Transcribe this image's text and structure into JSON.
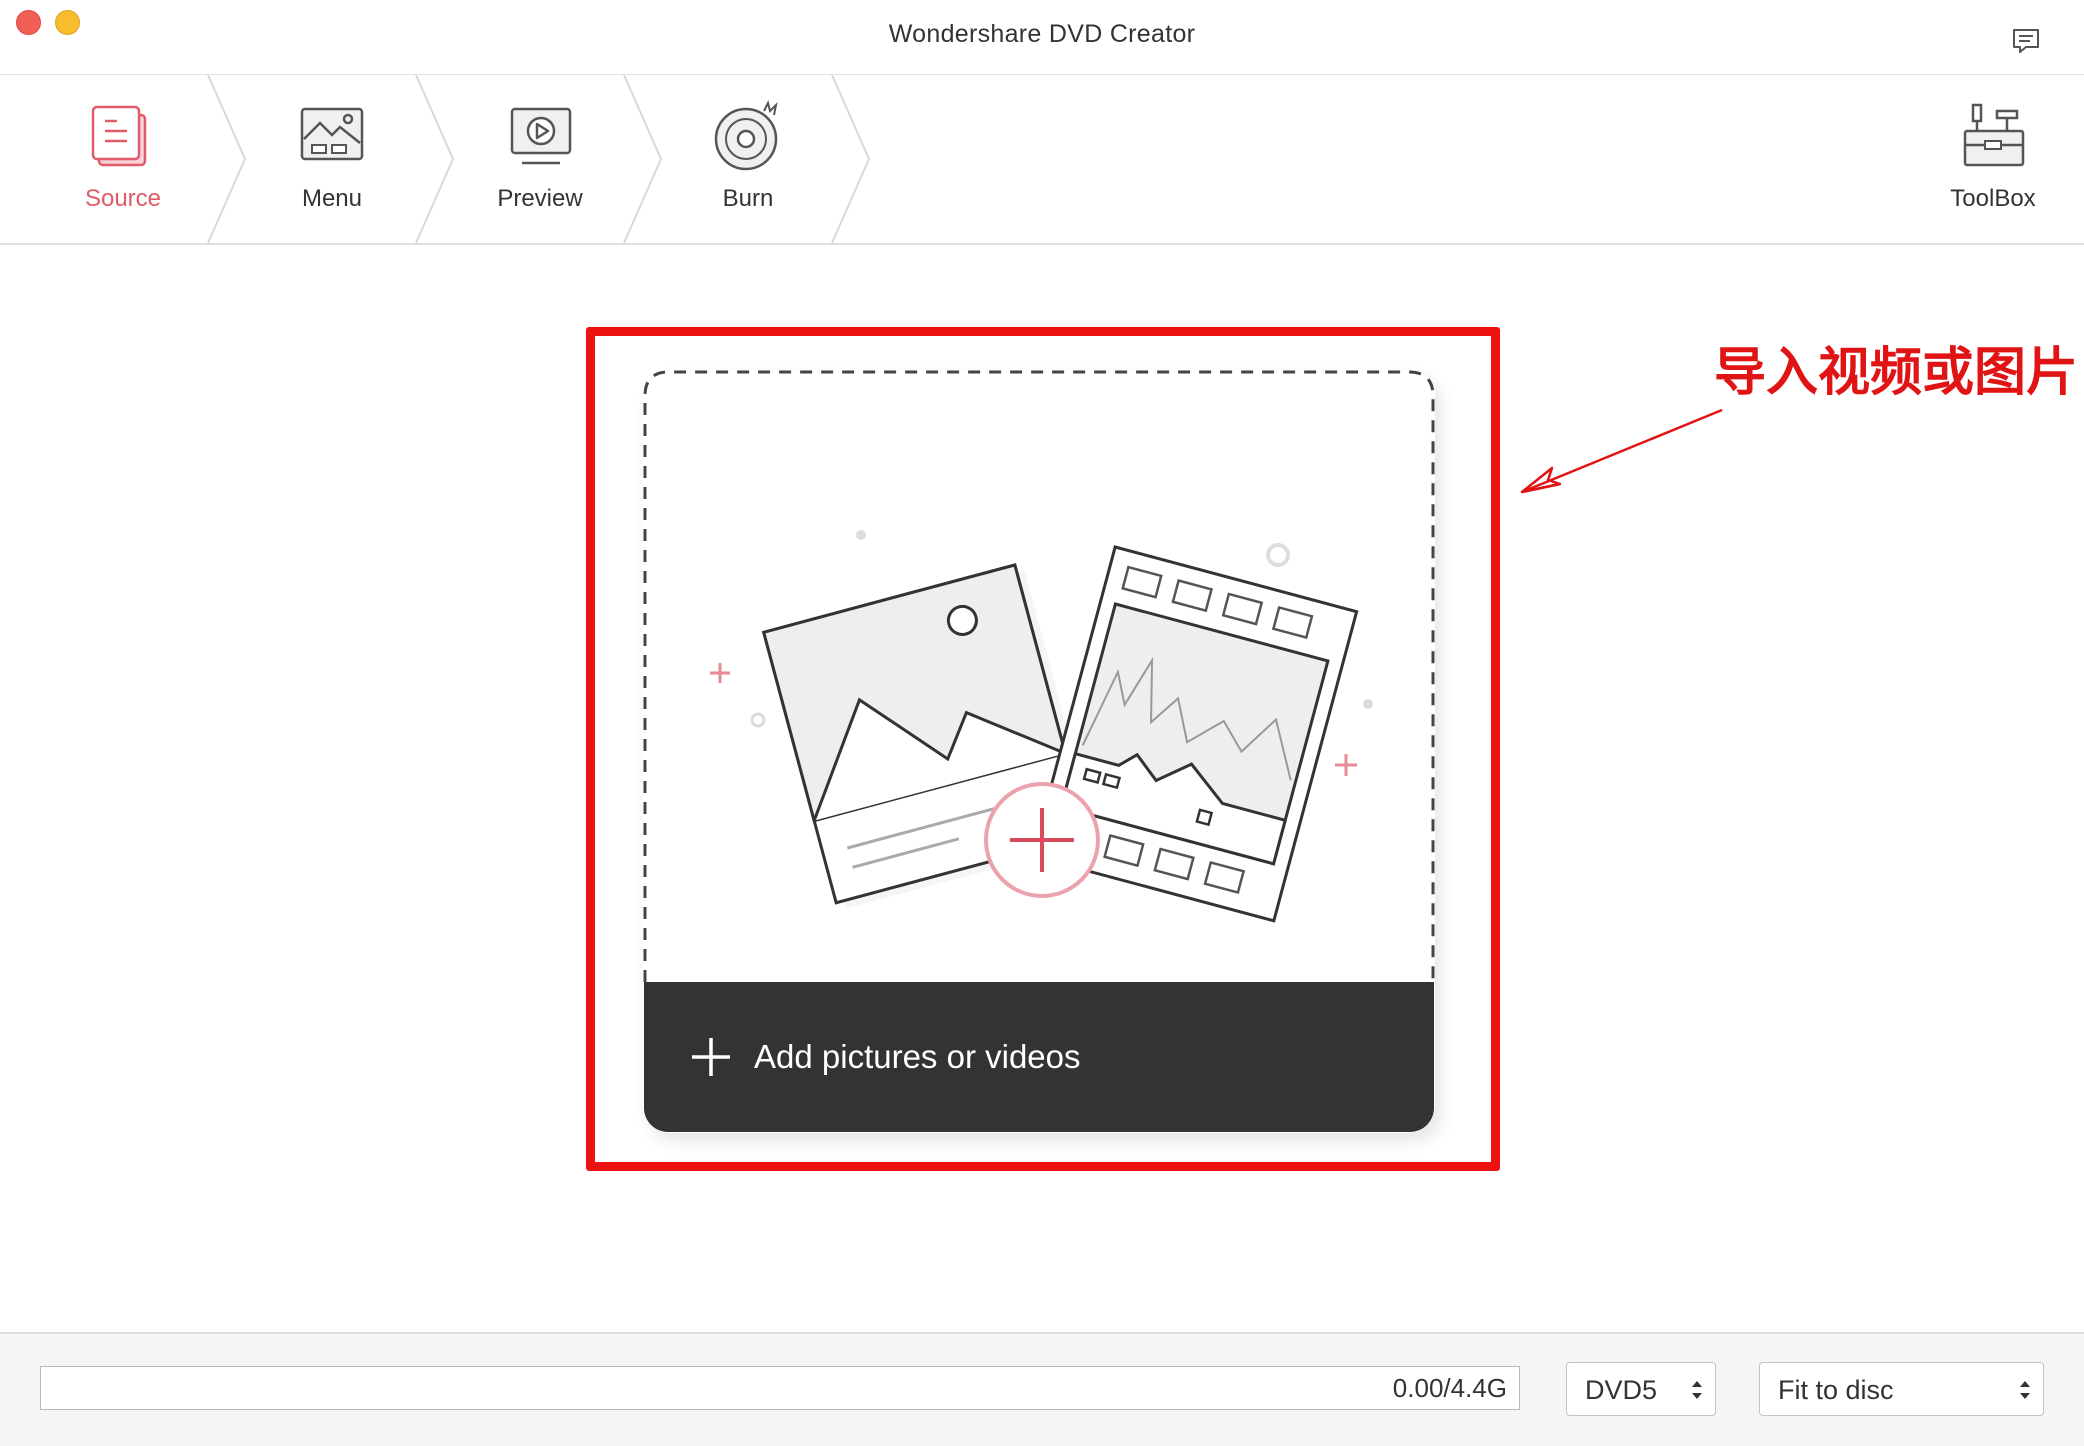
{
  "window": {
    "title": "Wondershare DVD Creator"
  },
  "toolbar": {
    "steps": [
      {
        "label": "Source",
        "icon": "source-icon",
        "active": true
      },
      {
        "label": "Menu",
        "icon": "menu-template-icon",
        "active": false
      },
      {
        "label": "Preview",
        "icon": "preview-monitor-icon",
        "active": false
      },
      {
        "label": "Burn",
        "icon": "burn-disc-icon",
        "active": false
      }
    ],
    "toolbox_label": "ToolBox"
  },
  "main": {
    "add_label": "Add pictures or videos",
    "annotation": "导入视频或图片"
  },
  "bottom": {
    "capacity_text": "0.00/4.4G",
    "disc_type": "DVD5",
    "fit_mode": "Fit to disc"
  },
  "colors": {
    "accent": "#e15b6a",
    "annotation_red": "#ee1111",
    "dark_bar": "#333333"
  }
}
